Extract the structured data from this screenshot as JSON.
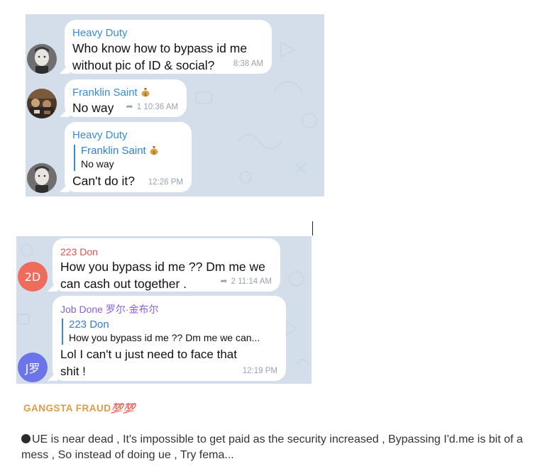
{
  "screenshot1": {
    "messages": [
      {
        "sender": "Heavy Duty",
        "lines": [
          "Who know how to bypass id me",
          "without pic of ID & social?"
        ],
        "time": "8:38 AM"
      },
      {
        "sender": "Franklin Saint",
        "text": "No way",
        "reply_count": "1",
        "time": "10:36 AM"
      },
      {
        "sender": "Heavy Duty",
        "quote_sender": "Franklin Saint",
        "quote_text": "No way",
        "text": "Can't do it?",
        "time": "12:26 PM"
      }
    ]
  },
  "screenshot2": {
    "messages": [
      {
        "sender": "223 Don",
        "avatar": "2D",
        "lines": [
          "How you bypass id me ?? Dm me we",
          "can cash out together ."
        ],
        "reply_count": "2",
        "time": "11:14 AM"
      },
      {
        "sender": "Job Done 罗尔·金布尔",
        "avatar": "J罗",
        "quote_sender": "223 Don",
        "quote_text": "How you bypass id me ?? Dm me we can...",
        "lines": [
          "Lol I can't u just need to face that",
          "shit !"
        ],
        "time": "12:19 PM"
      }
    ]
  },
  "post": {
    "title": "GANGSTA FRAUD",
    "title_emoji": "💯💯",
    "body": "UE is near dead , It's impossible to get paid as the security increased , Bypassing I'd.me is bit of a mess , So instead of doing ue , Try fema..."
  },
  "colors": {
    "chat_bg": "#d3deea",
    "heavy_duty_name": "#3a8bd6",
    "franklin_name": "#3a8bd6",
    "don_name": "#e0534e",
    "don_avatar": "#ef6b5b",
    "jobdone_name": "#8b5fd6",
    "jobdone_avatar": "#6b74e8",
    "post_title": "#e09a4a"
  }
}
